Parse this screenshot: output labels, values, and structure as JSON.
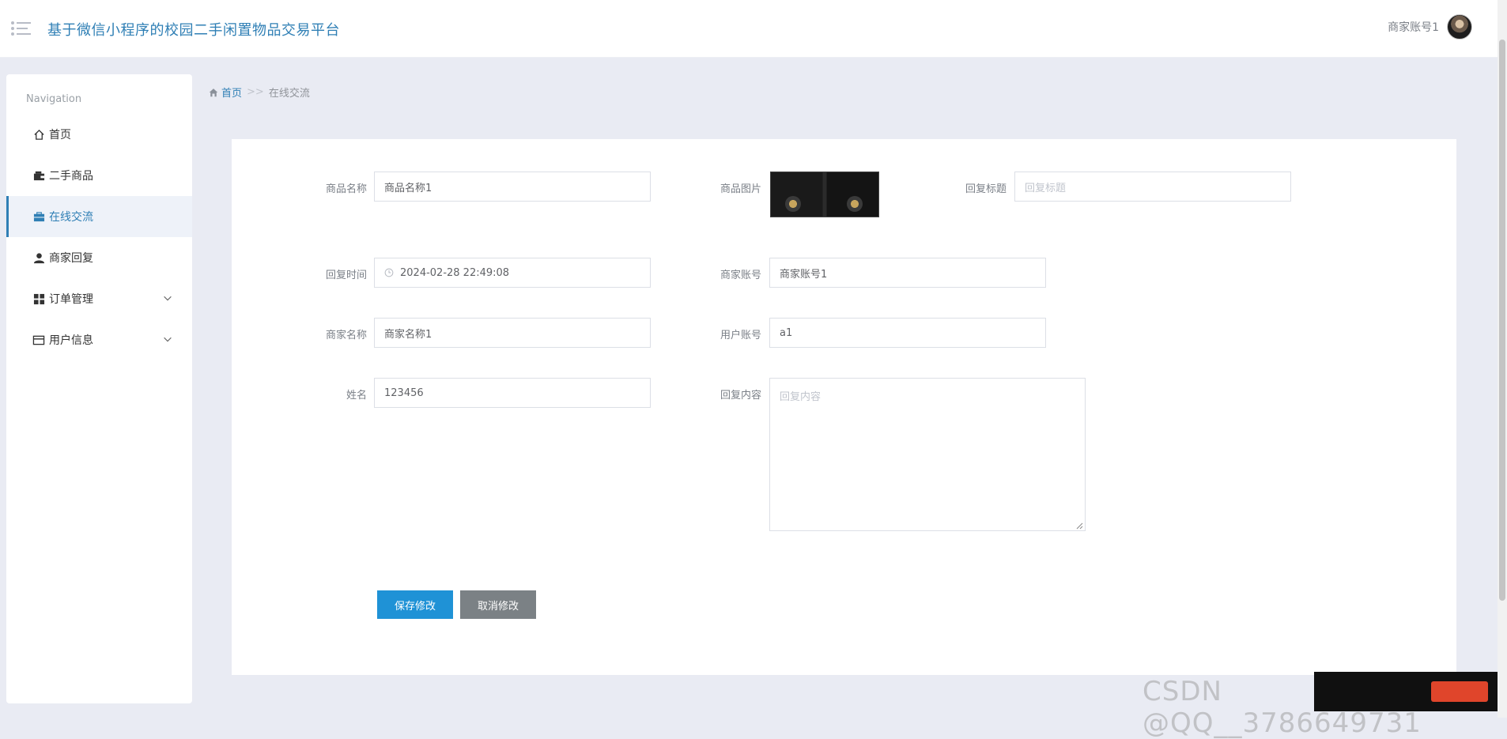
{
  "header": {
    "app_title": "基于微信小程序的校园二手闲置物品交易平台",
    "user_name": "商家账号1"
  },
  "sidebar": {
    "heading": "Navigation",
    "items": [
      {
        "label": "首页",
        "icon": "home-icon"
      },
      {
        "label": "二手商品",
        "icon": "wallet-icon"
      },
      {
        "label": "在线交流",
        "icon": "briefcase-icon",
        "active": true
      },
      {
        "label": "商家回复",
        "icon": "user-icon"
      },
      {
        "label": "订单管理",
        "icon": "grid-icon",
        "expandable": true
      },
      {
        "label": "用户信息",
        "icon": "card-icon",
        "expandable": true
      }
    ]
  },
  "breadcrumb": {
    "home": "首页",
    "separator": ">>",
    "current": "在线交流"
  },
  "form": {
    "product_name": {
      "label": "商品名称",
      "value": "商品名称1"
    },
    "product_image": {
      "label": "商品图片"
    },
    "reply_title": {
      "label": "回复标题",
      "placeholder": "回复标题"
    },
    "reply_time": {
      "label": "回复时间",
      "value": "2024-02-28 22:49:08"
    },
    "merchant_account": {
      "label": "商家账号",
      "value": "商家账号1"
    },
    "merchant_name": {
      "label": "商家名称",
      "value": "商家名称1"
    },
    "user_account": {
      "label": "用户账号",
      "value": "a1"
    },
    "name": {
      "label": "姓名",
      "value": "123456"
    },
    "reply_content": {
      "label": "回复内容",
      "placeholder": "回复内容"
    }
  },
  "buttons": {
    "save": "保存修改",
    "cancel": "取消修改"
  },
  "watermark": "CSDN @QQ__3786649731"
}
